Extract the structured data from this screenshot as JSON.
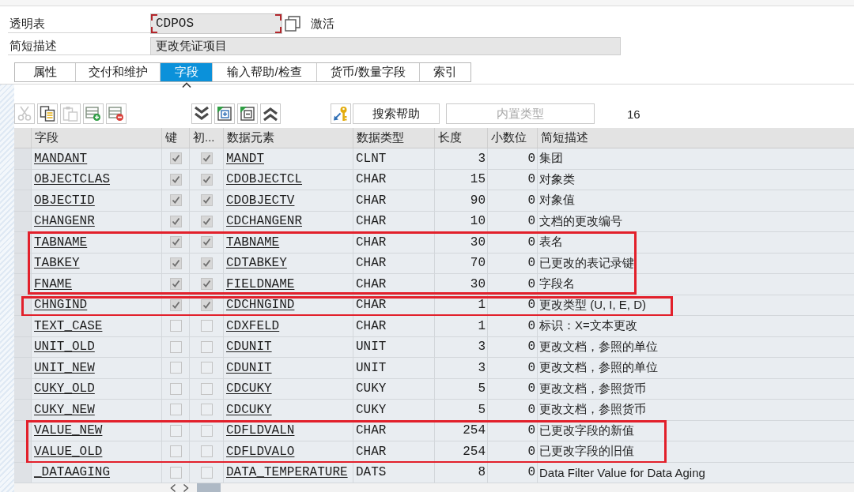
{
  "header": {
    "fields": [
      {
        "kind": "code",
        "label": "透明表",
        "value": "CDPOS",
        "focused": true,
        "status": "激活"
      },
      {
        "kind": "text",
        "label": "简短描述",
        "value": "更改凭证项目",
        "focused": false
      }
    ]
  },
  "tabs": [
    {
      "label": "属性",
      "selected": false
    },
    {
      "label": "交付和维护",
      "selected": false
    },
    {
      "label": "字段",
      "selected": true
    },
    {
      "label": "输入帮助/检查",
      "selected": false
    },
    {
      "label": "货币/数量字段",
      "selected": false
    },
    {
      "label": "索引",
      "selected": false
    }
  ],
  "toolbar": {
    "edit_buttons": [
      {
        "kind": "cut",
        "disabled": true
      },
      {
        "kind": "copy",
        "disabled": false
      },
      {
        "kind": "paste",
        "disabled": true
      },
      {
        "kind": "addrow",
        "disabled": false
      },
      {
        "kind": "delrow",
        "disabled": false
      }
    ],
    "tree_buttons": [
      {
        "kind": "down",
        "disabled": false
      },
      {
        "kind": "insert",
        "disabled": false
      },
      {
        "kind": "remove",
        "disabled": false
      },
      {
        "kind": "up",
        "disabled": false
      }
    ],
    "help_buttons": [
      {
        "kind": "key",
        "disabled": false
      }
    ],
    "text_buttons": [
      {
        "label": "搜索帮助",
        "disabled": false
      },
      {
        "label": "内置类型",
        "disabled": true
      }
    ],
    "count": "16"
  },
  "table": {
    "columns": [
      "字段",
      "键",
      "初...",
      "数据元素",
      "数据类型",
      "长度",
      "小数位",
      "简短描述"
    ],
    "row_groups": [
      {
        "highlighted": false,
        "rows": [
          {
            "field": "MANDANT",
            "key": true,
            "initial": true,
            "data_element": "MANDT",
            "data_type": "CLNT",
            "length": "3",
            "decimals": "0",
            "description": "集团"
          },
          {
            "field": "OBJECTCLAS",
            "key": true,
            "initial": true,
            "data_element": "CDOBJECTCL",
            "data_type": "CHAR",
            "length": "15",
            "decimals": "0",
            "description": "对象类"
          },
          {
            "field": "OBJECTID",
            "key": true,
            "initial": true,
            "data_element": "CDOBJECTV",
            "data_type": "CHAR",
            "length": "90",
            "decimals": "0",
            "description": "对象值"
          },
          {
            "field": "CHANGENR",
            "key": true,
            "initial": true,
            "data_element": "CDCHANGENR",
            "data_type": "CHAR",
            "length": "10",
            "decimals": "0",
            "description": "文档的更改编号"
          }
        ]
      },
      {
        "highlighted": true,
        "rows": [
          {
            "field": "TABNAME",
            "key": true,
            "initial": true,
            "data_element": "TABNAME",
            "data_type": "CHAR",
            "length": "30",
            "decimals": "0",
            "description": "表名"
          },
          {
            "field": "TABKEY",
            "key": true,
            "initial": true,
            "data_element": "CDTABKEY",
            "data_type": "CHAR",
            "length": "70",
            "decimals": "0",
            "description": "已更改的表记录键"
          },
          {
            "field": "FNAME",
            "key": true,
            "initial": true,
            "data_element": "FIELDNAME",
            "data_type": "CHAR",
            "length": "30",
            "decimals": "0",
            "description": "字段名"
          }
        ]
      },
      {
        "highlighted": true,
        "rows": [
          {
            "field": "CHNGIND",
            "key": true,
            "initial": true,
            "data_element": "CDCHNGIND",
            "data_type": "CHAR",
            "length": "1",
            "decimals": "0",
            "description": "更改类型 (U, I, E, D)"
          }
        ]
      },
      {
        "highlighted": false,
        "rows": [
          {
            "field": "TEXT_CASE",
            "key": false,
            "initial": false,
            "data_element": "CDXFELD",
            "data_type": "CHAR",
            "length": "1",
            "decimals": "0",
            "description": "标识：X=文本更改"
          },
          {
            "field": "UNIT_OLD",
            "key": false,
            "initial": false,
            "data_element": "CDUNIT",
            "data_type": "UNIT",
            "length": "3",
            "decimals": "0",
            "description": "更改文档，参照的单位"
          },
          {
            "field": "UNIT_NEW",
            "key": false,
            "initial": false,
            "data_element": "CDUNIT",
            "data_type": "UNIT",
            "length": "3",
            "decimals": "0",
            "description": "更改文档，参照的单位"
          },
          {
            "field": "CUKY_OLD",
            "key": false,
            "initial": false,
            "data_element": "CDCUKY",
            "data_type": "CUKY",
            "length": "5",
            "decimals": "0",
            "description": "更改文档，参照货币"
          },
          {
            "field": "CUKY_NEW",
            "key": false,
            "initial": false,
            "data_element": "CDCUKY",
            "data_type": "CUKY",
            "length": "5",
            "decimals": "0",
            "description": "更改文档，参照货币"
          }
        ]
      },
      {
        "highlighted": true,
        "rows": [
          {
            "field": "VALUE_NEW",
            "key": false,
            "initial": false,
            "data_element": "CDFLDVALN",
            "data_type": "CHAR",
            "length": "254",
            "decimals": "0",
            "description": "已更改字段的新值"
          },
          {
            "field": "VALUE_OLD",
            "key": false,
            "initial": false,
            "data_element": "CDFLDVALO",
            "data_type": "CHAR",
            "length": "254",
            "decimals": "0",
            "description": "已更改字段的旧值"
          }
        ]
      },
      {
        "highlighted": false,
        "rows": [
          {
            "field": "_DATAAGING",
            "key": false,
            "initial": false,
            "data_element": "DATA_TEMPERATURE",
            "data_type": "DATS",
            "length": "8",
            "decimals": "0",
            "description": "Data Filter Value for Data Aging"
          }
        ]
      }
    ]
  }
}
